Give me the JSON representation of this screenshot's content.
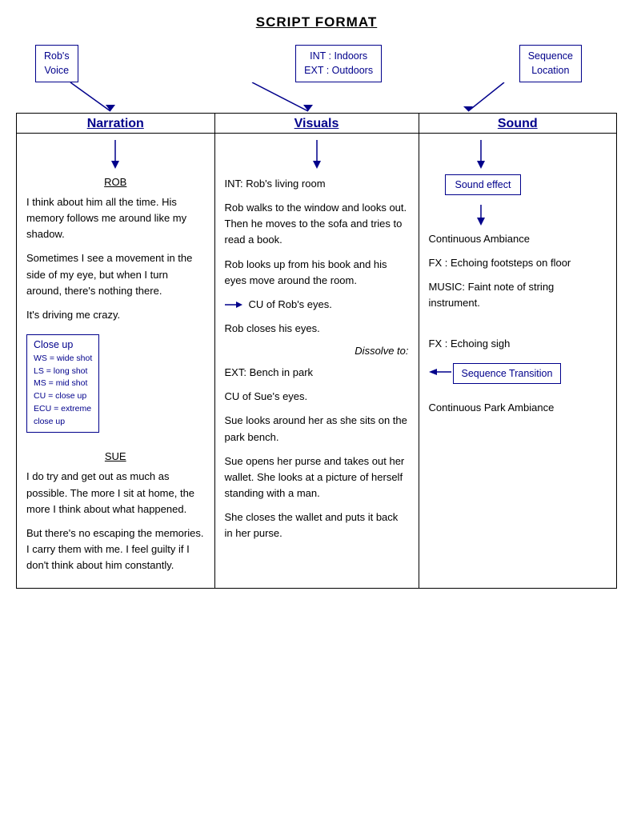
{
  "page": {
    "title": "Script Format",
    "annotations": {
      "robs_voice": {
        "line1": "Rob's",
        "line2": "Voice"
      },
      "int_ext": {
        "line1": "INT : Indoors",
        "line2": "EXT : Outdoors"
      },
      "seq_loc": {
        "line1": "Sequence",
        "line2": "Location"
      }
    },
    "columns": {
      "narration": {
        "header": "Narration",
        "content": [
          {
            "type": "character",
            "text": "ROB"
          },
          {
            "type": "paragraph",
            "text": "I think about him all the time. His memory follows me around like my shadow."
          },
          {
            "type": "paragraph",
            "text": "Sometimes I see a movement in the side of my eye, but when I turn around, there's nothing there."
          },
          {
            "type": "paragraph",
            "text": "It's driving me crazy."
          },
          {
            "type": "close-up-box",
            "title": "Close up",
            "legend": [
              "WS = wide shot",
              "LS = long shot",
              "MS = mid shot",
              "CU = close up",
              "ECU = extreme close up"
            ]
          },
          {
            "type": "character",
            "text": "SUE"
          },
          {
            "type": "paragraph",
            "text": "I do try and get out as much as possible. The more I sit at home, the more I think about what happened."
          },
          {
            "type": "paragraph",
            "text": "But there's no escaping the memories. I carry them with me. I feel guilty if I don't think about him constantly."
          }
        ]
      },
      "visuals": {
        "header": "Visuals",
        "content": [
          {
            "type": "paragraph",
            "text": "INT: Rob's living room"
          },
          {
            "type": "paragraph",
            "text": "Rob walks to the window and looks out. Then he moves to the sofa and tries to read a book."
          },
          {
            "type": "paragraph",
            "text": "Rob looks up from his book and his eyes move around the room."
          },
          {
            "type": "paragraph",
            "text": "CU of Rob's eyes."
          },
          {
            "type": "paragraph",
            "text": "Rob closes his eyes."
          },
          {
            "type": "dissolve",
            "text": "Dissolve to:"
          },
          {
            "type": "paragraph",
            "text": "EXT: Bench in park"
          },
          {
            "type": "paragraph",
            "text": "CU of Sue's eyes."
          },
          {
            "type": "paragraph",
            "text": "Sue looks around her as she sits on the park bench."
          },
          {
            "type": "paragraph",
            "text": "Sue opens her purse and takes out her wallet. She looks at a picture of herself standing with a man."
          },
          {
            "type": "paragraph",
            "text": "She closes the wallet and puts it back in her purse."
          }
        ]
      },
      "sound": {
        "header": "Sound",
        "content": [
          {
            "type": "sound-effect-box",
            "text": "Sound effect"
          },
          {
            "type": "paragraph",
            "text": "Continuous Ambiance"
          },
          {
            "type": "paragraph",
            "text": "FX : Echoing footsteps on floor"
          },
          {
            "type": "paragraph",
            "text": "MUSIC: Faint note of string instrument."
          },
          {
            "type": "paragraph",
            "text": "FX : Echoing sigh"
          },
          {
            "type": "seq-transition-box",
            "text": "Sequence Transition"
          },
          {
            "type": "paragraph",
            "text": "Continuous Park Ambiance"
          }
        ]
      }
    }
  }
}
